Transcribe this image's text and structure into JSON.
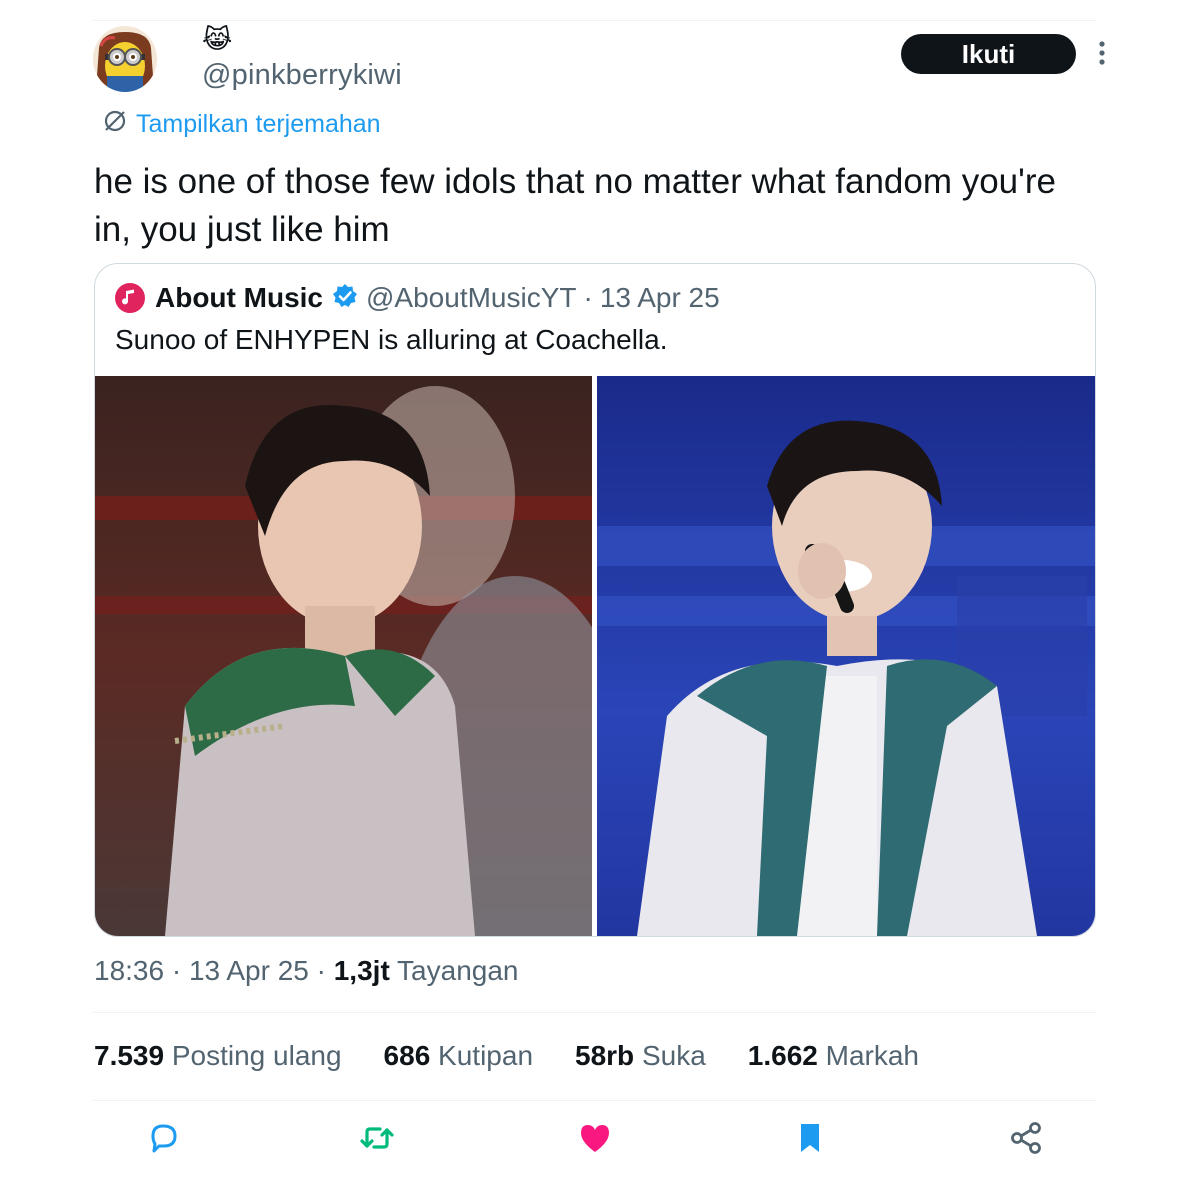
{
  "tweet": {
    "display_name_emoji": "😹",
    "handle": "@pinkberrykiwi",
    "follow_label": "Ikuti",
    "translate_label": "Tampilkan terjemahan",
    "text": "he is one of those few idols that no matter what fandom you're in, you just like him",
    "time": "18:36",
    "date": "13 Apr 25",
    "views_count": "1,3jt",
    "views_label": "Tayangan"
  },
  "quote": {
    "name": "About Music",
    "handle": "@AboutMusicYT",
    "separator": "·",
    "date": "13 Apr 25",
    "text": "Sunoo of ENHYPEN is alluring at Coachella."
  },
  "stats": {
    "reposts_count": "7.539",
    "reposts_label": "Posting ulang",
    "quotes_count": "686",
    "quotes_label": "Kutipan",
    "likes_count": "58rb",
    "likes_label": "Suka",
    "bookmarks_count": "1.662",
    "bookmarks_label": "Markah"
  },
  "icons": {
    "avatar": "minion-avatar",
    "more": "more-icon",
    "translate": "translate-icon",
    "verified": "verified-badge-icon",
    "reply": "reply-icon",
    "repost": "repost-icon",
    "like": "heart-icon",
    "bookmark": "bookmark-icon",
    "share": "share-icon"
  },
  "colors": {
    "accent_blue": "#1d9bf0",
    "repost_green": "#00ba7c",
    "like_pink": "#f91880",
    "follow_button": "#0f1419",
    "secondary_text": "#536471"
  }
}
